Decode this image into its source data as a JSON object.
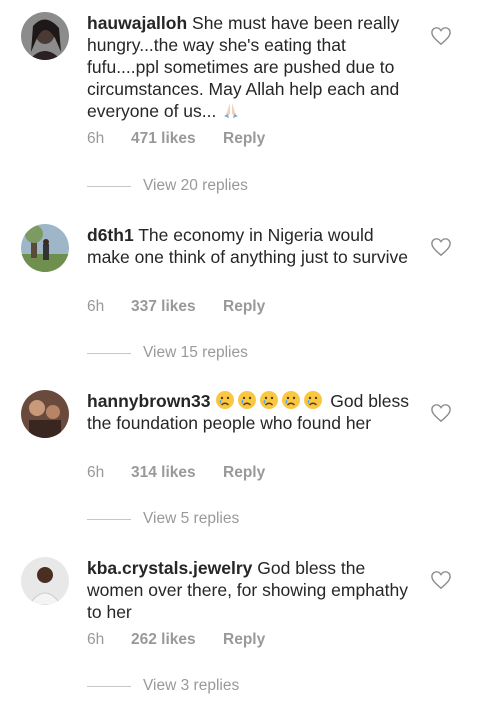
{
  "comments": [
    {
      "username": "hauwajalloh",
      "text": "She must have been really hungry...the way she's eating that fufu....ppl sometimes are pushed due to circumstances. May Allah help each and everyone of us...",
      "time": "6h",
      "likes": "471 likes",
      "reply": "Reply",
      "view_replies": "View 20 replies",
      "avatar_icon": "avatar-photo-woman"
    },
    {
      "username": "d6th1",
      "text": "The economy in Nigeria would make one think of anything just to survive",
      "time": "6h",
      "likes": "337 likes",
      "reply": "Reply",
      "view_replies": "View 15 replies",
      "avatar_icon": "avatar-photo-outdoor"
    },
    {
      "username": "hannybrown33",
      "text": "God bless the foundation people who  found her",
      "time": "6h",
      "likes": "314 likes",
      "reply": "Reply",
      "view_replies": "View 5 replies",
      "avatar_icon": "avatar-photo-dark"
    },
    {
      "username": "kba.crystals.jewelry",
      "text": "God bless the women over there,  for showing emphathy to her",
      "time": "6h",
      "likes": "262 likes",
      "reply": "Reply",
      "view_replies": "View 3 replies",
      "avatar_icon": "avatar-photo-man"
    }
  ],
  "colors": {
    "text": "#262626",
    "muted": "#999999",
    "divider": "#c7c7c7"
  },
  "icons": {
    "like": "heart-outline-icon",
    "praying_hands": "folded-hands-emoji",
    "crying_face": "crying-face-emoji"
  }
}
